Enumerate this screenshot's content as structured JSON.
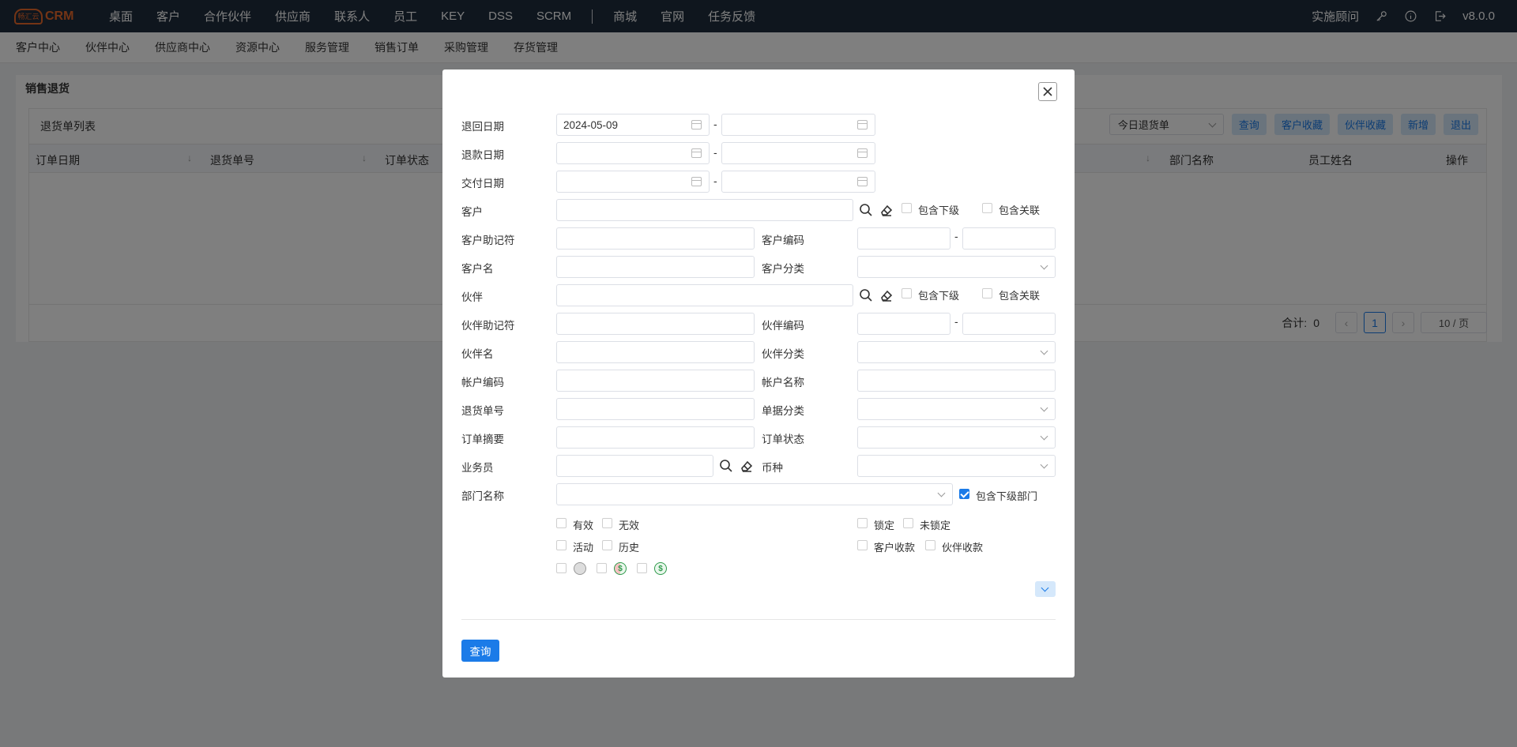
{
  "app": {
    "logo_mark": "畅汇云",
    "logo_text": "CRM",
    "version": "v8.0.0",
    "consultant": "实施顾问"
  },
  "topnav": [
    "桌面",
    "客户",
    "合作伙伴",
    "供应商",
    "联系人",
    "员工",
    "KEY",
    "DSS",
    "SCRM",
    "商城",
    "官网",
    "任务反馈"
  ],
  "subnav": [
    "客户中心",
    "伙伴中心",
    "供应商中心",
    "资源中心",
    "服务管理",
    "销售订单",
    "采购管理",
    "存货管理"
  ],
  "page": {
    "title": "销售退货",
    "list_title": "退货单列表",
    "filter_select": "今日退货单",
    "buttons": [
      "查询",
      "客户收藏",
      "伙伴收藏",
      "新增",
      "退出"
    ],
    "columns": [
      "订单日期",
      "退货单号",
      "订单状态",
      "部门名称",
      "员工姓名",
      "操作"
    ],
    "pager": {
      "total_label": "合计:",
      "total": "0",
      "current": "1",
      "page_size": "10 / 页"
    }
  },
  "modal": {
    "labels": {
      "return_date": "退回日期",
      "refund_date": "退款日期",
      "delivery_date": "交付日期",
      "customer": "客户",
      "customer_mnemonic": "客户助记符",
      "customer_code": "客户编码",
      "customer_name": "客户名",
      "customer_category": "客户分类",
      "partner": "伙伴",
      "partner_mnemonic": "伙伴助记符",
      "partner_code": "伙伴编码",
      "partner_name": "伙伴名",
      "partner_category": "伙伴分类",
      "account_code": "帐户编码",
      "account_name": "帐户名称",
      "return_no": "退货单号",
      "doc_category": "单据分类",
      "order_summary": "订单摘要",
      "order_status": "订单状态",
      "salesperson": "业务员",
      "currency": "币种",
      "department": "部门名称"
    },
    "values": {
      "return_date_from": "2024-05-09"
    },
    "dash": "-",
    "checkboxes": {
      "include_sub": "包含下级",
      "include_rel": "包含关联",
      "include_sub_dept": "包含下级部门",
      "valid": "有效",
      "invalid": "无效",
      "locked": "锁定",
      "unlocked": "未锁定",
      "active": "活动",
      "history": "历史",
      "customer_receipt": "客户收款",
      "partner_receipt": "伙伴收款"
    },
    "money_symbol": "$",
    "query_button": "查询"
  }
}
